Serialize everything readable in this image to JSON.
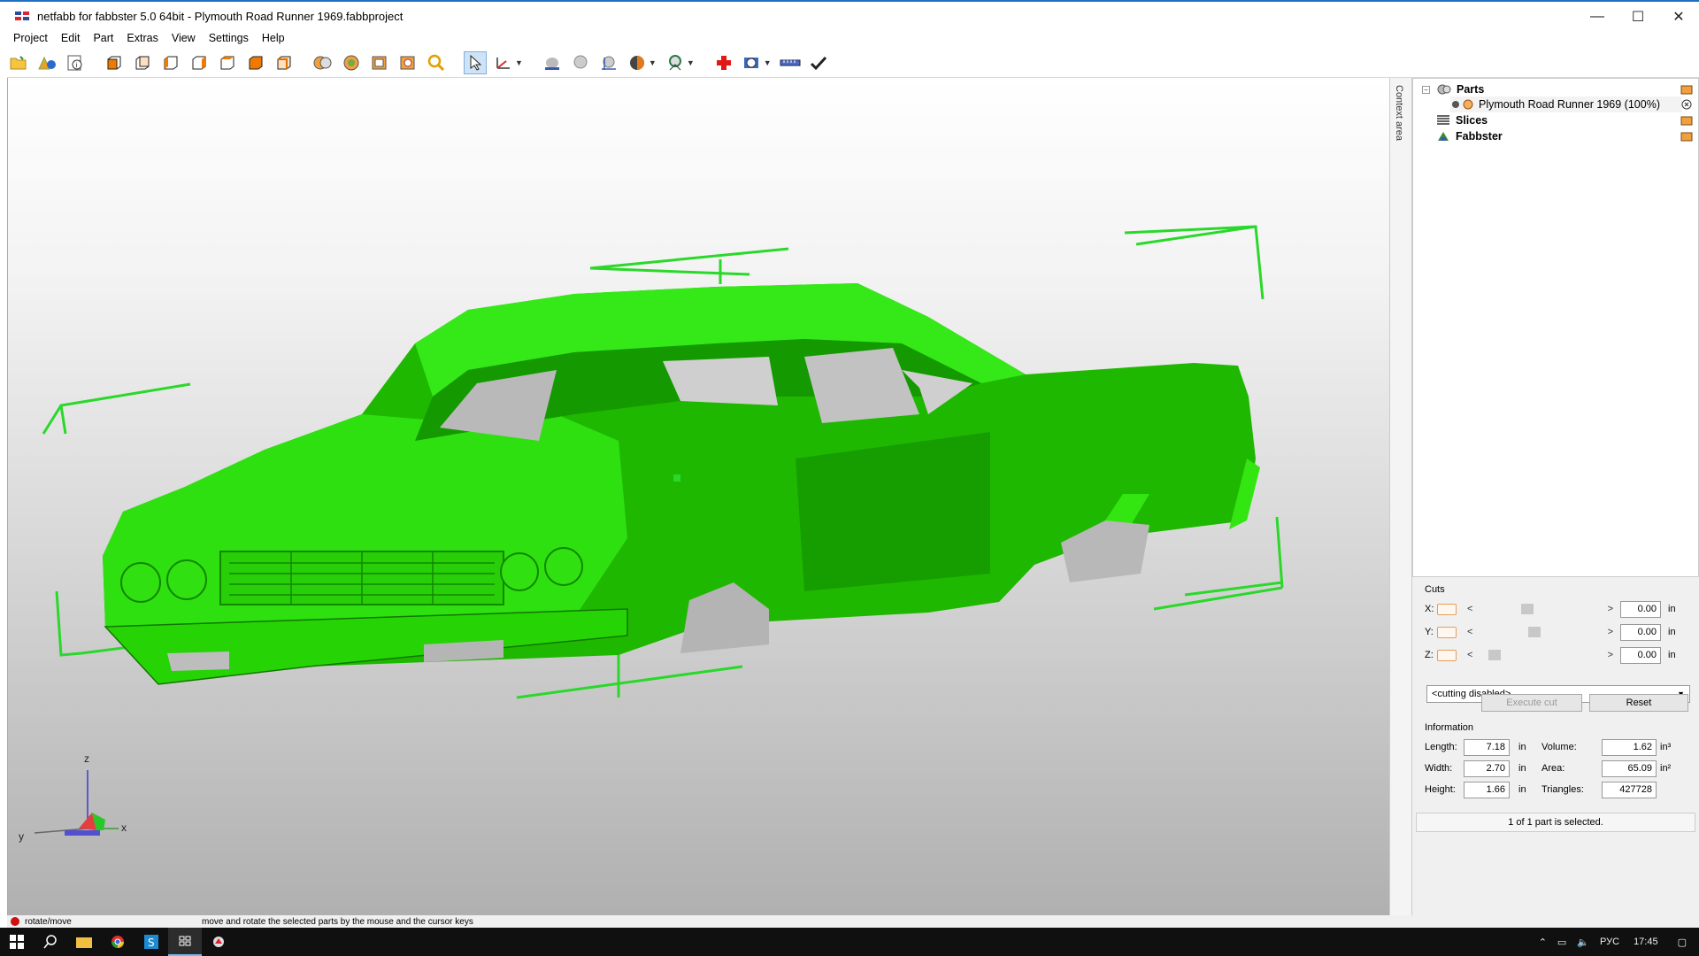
{
  "window": {
    "title": "netfabb for fabbster 5.0 64bit - Plymouth Road Runner 1969.fabbproject",
    "controls": {
      "minimize": "—",
      "maximize": "☐",
      "close": "✕"
    }
  },
  "menu": [
    "Project",
    "Edit",
    "Part",
    "Extras",
    "View",
    "Settings",
    "Help"
  ],
  "toolbar": {
    "icons": [
      "open-project-icon",
      "add-part-icon",
      "project-info-icon",
      "view-front-icon",
      "view-back-icon",
      "view-left-icon",
      "view-right-icon",
      "view-top-icon",
      "view-bottom-icon",
      "view-iso-icon",
      "repair-icon",
      "analyze-icon",
      "mesh-icon",
      "measure-icon",
      "zoom-icon",
      "select-cursor-icon",
      "move-axis-icon",
      "shading-icon",
      "smooth-icon",
      "slice-view-icon",
      "material-icon",
      "support-icon",
      "add-repair-icon",
      "settings-gear-icon",
      "ruler-icon",
      "apply-check-icon"
    ]
  },
  "viewport": {
    "model_color": "#22dd00",
    "axes": {
      "z": "z",
      "x": "x",
      "y": "y"
    }
  },
  "context_area_label": "Context area",
  "tree": {
    "parts_label": "Parts",
    "part_name": "Plymouth Road Runner 1969 (100%)",
    "slices_label": "Slices",
    "fabbster_label": "Fabbster"
  },
  "cuts": {
    "title": "Cuts",
    "rows": [
      {
        "axis": "X:",
        "value": "0.00",
        "unit": "in",
        "slider": 0.38
      },
      {
        "axis": "Y:",
        "value": "0.00",
        "unit": "in",
        "slider": 0.45
      },
      {
        "axis": "Z:",
        "value": "0.00",
        "unit": "in",
        "slider": 0.08
      }
    ],
    "mode": "<cutting disabled>",
    "execute_label": "Execute cut",
    "reset_label": "Reset"
  },
  "information": {
    "title": "Information",
    "length_label": "Length:",
    "length": "7.18",
    "width_label": "Width:",
    "width": "2.70",
    "height_label": "Height:",
    "height": "1.66",
    "unit": "in",
    "volume_label": "Volume:",
    "volume": "1.62",
    "volume_unit": "in³",
    "area_label": "Area:",
    "area": "65.09",
    "area_unit": "in²",
    "triangles_label": "Triangles:",
    "triangles": "427728"
  },
  "selection_status": "1 of 1 part is selected.",
  "statusbar": {
    "mode": "rotate/move",
    "hint": "move and rotate the selected parts by the mouse and the cursor keys"
  },
  "taskbar": {
    "language": "РУС",
    "time": "17:45"
  }
}
